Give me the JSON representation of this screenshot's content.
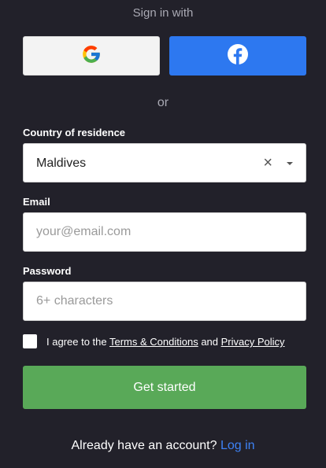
{
  "header": {
    "title": "Sign in with"
  },
  "social": {
    "google_icon": "google-logo",
    "facebook_icon": "facebook-logo",
    "google_bg": "#f3f3f3",
    "facebook_bg": "#2d78f0"
  },
  "divider": {
    "text": "or"
  },
  "country": {
    "label": "Country of residence",
    "value": "Maldives",
    "clear_icon": "×"
  },
  "email": {
    "label": "Email",
    "placeholder": "your@email.com",
    "value": ""
  },
  "password": {
    "label": "Password",
    "placeholder": "6+ characters",
    "value": ""
  },
  "agreement": {
    "prefix": "I agree to the ",
    "terms_link": "Terms & Conditions",
    "conjunction": " and ",
    "privacy_link": "Privacy Policy",
    "checked": false
  },
  "cta": {
    "label": "Get started",
    "color": "#59a958"
  },
  "footer": {
    "prompt": "Already have an account?",
    "login_link": "Log in",
    "link_color": "#3d82f5"
  }
}
